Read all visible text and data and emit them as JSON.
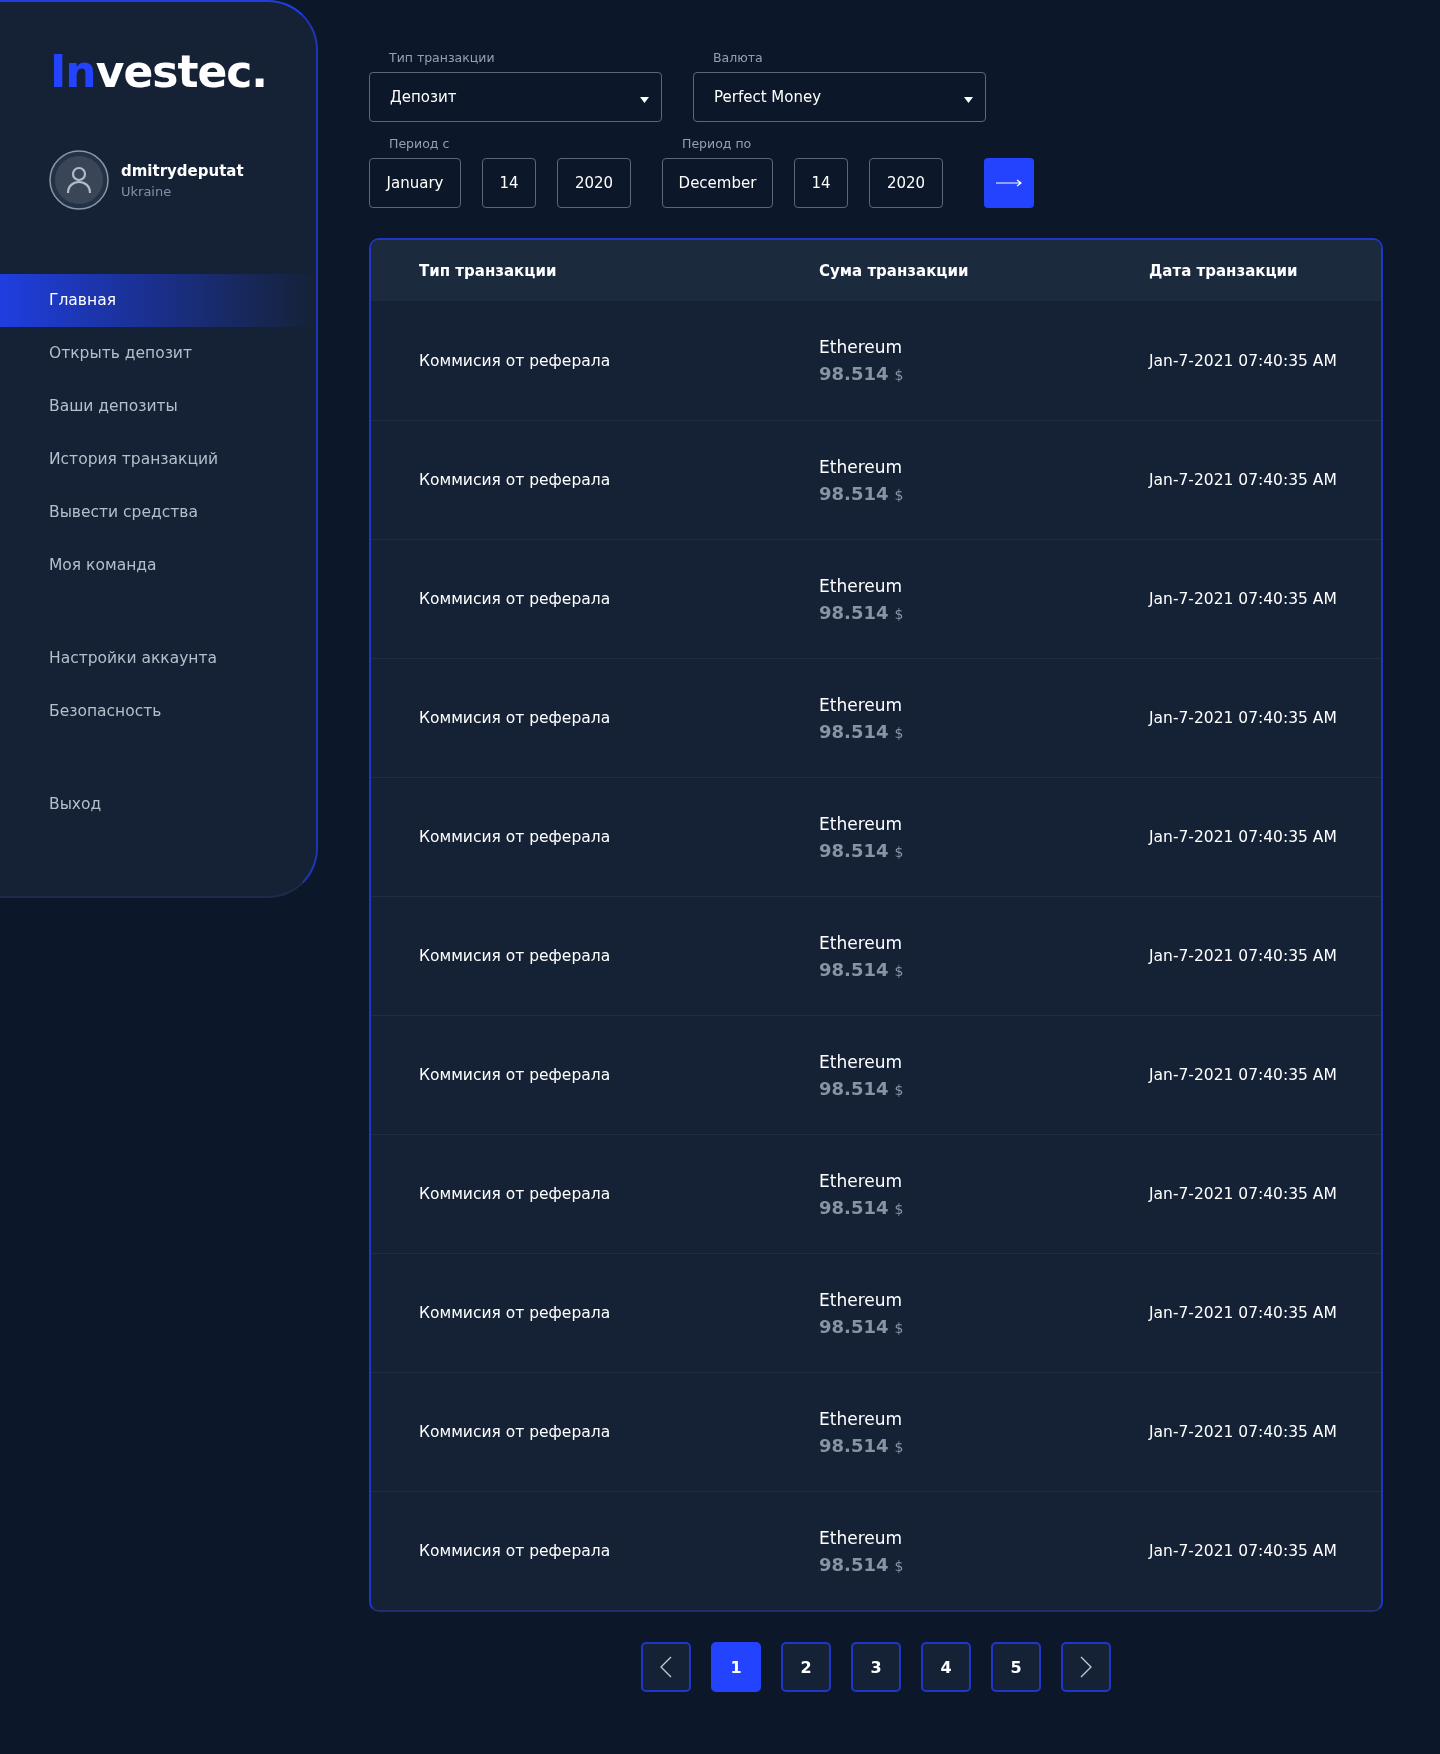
{
  "sidebar": {
    "logo": {
      "accent": "In",
      "rest": "vestec."
    },
    "user": {
      "name": "dmitrydeputat",
      "country": "Ukraine"
    },
    "nav_groups": [
      {
        "items": [
          {
            "label": "Главная",
            "selected": true
          },
          {
            "label": "Открыть депозит",
            "selected": false
          },
          {
            "label": "Ваши депозиты",
            "selected": false
          },
          {
            "label": "История транзакций",
            "selected": false
          },
          {
            "label": "Вывести средства",
            "selected": false
          },
          {
            "label": "Моя команда",
            "selected": false
          }
        ]
      },
      {
        "items": [
          {
            "label": "Настройки аккаунта",
            "selected": false
          },
          {
            "label": "Безопасность",
            "selected": false
          }
        ]
      },
      {
        "items": [
          {
            "label": "Выход",
            "selected": false
          }
        ]
      }
    ]
  },
  "filters": {
    "transaction_type": {
      "label": "Тип транзакции",
      "value": "Депозит"
    },
    "currency": {
      "label": "Валюта",
      "value": "Perfect Money"
    },
    "period_from": {
      "label": "Период с",
      "month": "January",
      "day": "14",
      "year": "2020"
    },
    "period_to": {
      "label": "Период по",
      "month": "December",
      "day": "14",
      "year": "2020"
    }
  },
  "table": {
    "columns": [
      "Тип транзакции",
      "Сума транзакции",
      "Дата транзакции"
    ],
    "rows": [
      {
        "type": "Коммисия от реферала",
        "currency": "Ethereum",
        "amount": "98.514",
        "unit": "$",
        "date": "Jan-7-2021 07:40:35 AM"
      },
      {
        "type": "Коммисия от реферала",
        "currency": "Ethereum",
        "amount": "98.514",
        "unit": "$",
        "date": "Jan-7-2021 07:40:35 AM"
      },
      {
        "type": "Коммисия от реферала",
        "currency": "Ethereum",
        "amount": "98.514",
        "unit": "$",
        "date": "Jan-7-2021 07:40:35 AM"
      },
      {
        "type": "Коммисия от реферала",
        "currency": "Ethereum",
        "amount": "98.514",
        "unit": "$",
        "date": "Jan-7-2021 07:40:35 AM"
      },
      {
        "type": "Коммисия от реферала",
        "currency": "Ethereum",
        "amount": "98.514",
        "unit": "$",
        "date": "Jan-7-2021 07:40:35 AM"
      },
      {
        "type": "Коммисия от реферала",
        "currency": "Ethereum",
        "amount": "98.514",
        "unit": "$",
        "date": "Jan-7-2021 07:40:35 AM"
      },
      {
        "type": "Коммисия от реферала",
        "currency": "Ethereum",
        "amount": "98.514",
        "unit": "$",
        "date": "Jan-7-2021 07:40:35 AM"
      },
      {
        "type": "Коммисия от реферала",
        "currency": "Ethereum",
        "amount": "98.514",
        "unit": "$",
        "date": "Jan-7-2021 07:40:35 AM"
      },
      {
        "type": "Коммисия от реферала",
        "currency": "Ethereum",
        "amount": "98.514",
        "unit": "$",
        "date": "Jan-7-2021 07:40:35 AM"
      },
      {
        "type": "Коммисия от реферала",
        "currency": "Ethereum",
        "amount": "98.514",
        "unit": "$",
        "date": "Jan-7-2021 07:40:35 AM"
      },
      {
        "type": "Коммисия от реферала",
        "currency": "Ethereum",
        "amount": "98.514",
        "unit": "$",
        "date": "Jan-7-2021 07:40:35 AM"
      }
    ]
  },
  "pagination": {
    "pages": [
      {
        "label": "1",
        "selected": true
      },
      {
        "label": "2",
        "selected": false
      },
      {
        "label": "3",
        "selected": false
      },
      {
        "label": "4",
        "selected": false
      },
      {
        "label": "5",
        "selected": false
      }
    ]
  }
}
